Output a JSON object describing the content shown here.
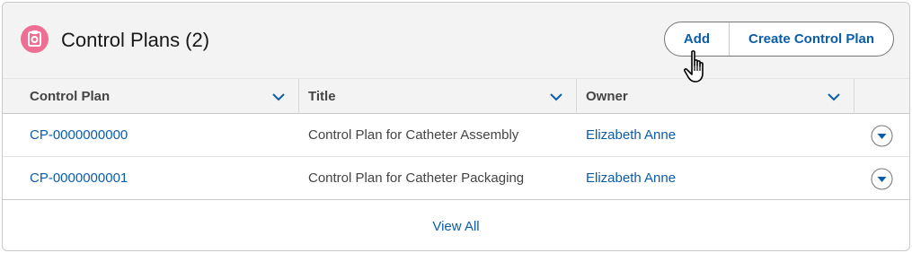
{
  "card": {
    "title": "Control Plans (2)",
    "icon": "control-plan-icon",
    "accent_color": "#ef6e93"
  },
  "actions": {
    "add_label": "Add",
    "create_label": "Create Control Plan"
  },
  "table": {
    "columns": [
      {
        "label": "Control Plan"
      },
      {
        "label": "Title"
      },
      {
        "label": "Owner"
      }
    ],
    "rows": [
      {
        "control_plan": "CP-0000000000",
        "title": "Control Plan for Catheter Assembly",
        "owner": "Elizabeth Anne"
      },
      {
        "control_plan": "CP-0000000001",
        "title": "Control Plan for Catheter Packaging",
        "owner": "Elizabeth Anne"
      }
    ]
  },
  "footer": {
    "view_all_label": "View All"
  },
  "colors": {
    "link": "#0b5cab",
    "header_bg": "#f3f3f3",
    "border": "#c9c9c9"
  }
}
